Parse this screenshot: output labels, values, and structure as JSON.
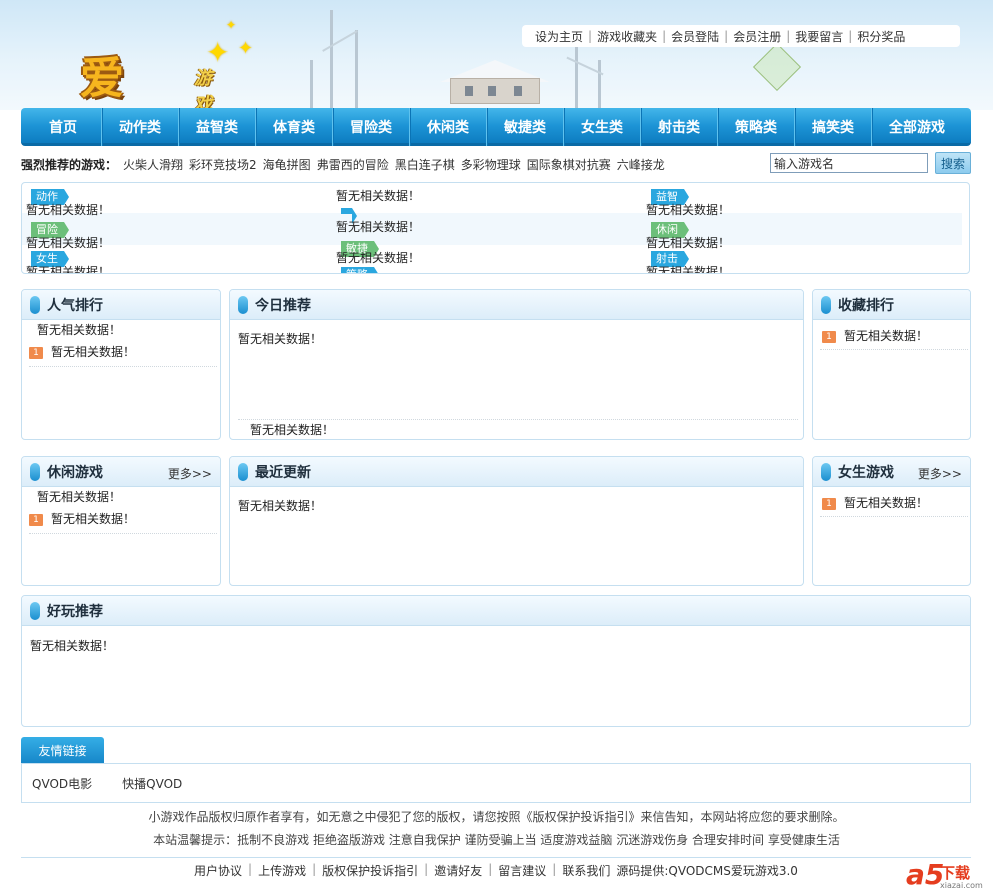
{
  "header": {
    "logo_main": "爱玩",
    "logo_sub": "游戏",
    "top_links": [
      "设为主页",
      "游戏收藏夹",
      "会员登陆",
      "会员注册",
      "我要留言",
      "积分奖品"
    ]
  },
  "nav": [
    "首页",
    "动作类",
    "益智类",
    "体育类",
    "冒险类",
    "休闲类",
    "敏捷类",
    "女生类",
    "射击类",
    "策略类",
    "搞笑类",
    "全部游戏"
  ],
  "recommend": {
    "label": "强烈推荐的游戏：",
    "games": [
      "火柴人滑翔",
      "彩环竞技场2",
      "海龟拼图",
      "弗雷西的冒险",
      "黑白连子棋",
      "多彩物理球",
      "国际象棋对抗赛",
      "六峰接龙"
    ]
  },
  "search": {
    "placeholder": "输入游戏名",
    "button": "搜索"
  },
  "empty_text": "暂无相关数据！",
  "categories": {
    "action": "动作",
    "puzzle": "益智",
    "sports": "体育",
    "adventure": "冒险",
    "casual": "休闲",
    "agile": "敏捷",
    "girls": "女生",
    "strategy": "策略",
    "shooting": "射击"
  },
  "panels": {
    "popular": "人气排行",
    "today": "今日推荐",
    "favorite": "收藏排行",
    "casual_games": "休闲游戏",
    "latest": "最近更新",
    "girls_games": "女生游戏",
    "fun": "好玩推荐",
    "more": "更多>>",
    "rank_number": "1"
  },
  "friends": {
    "tab": "友情链接",
    "links": [
      "QVOD电影",
      "快播QVOD"
    ]
  },
  "footer": {
    "copyright": "小游戏作品版权归原作者享有，如无意之中侵犯了您的版权，请您按照《版权保护投诉指引》来信告知，本网站将应您的要求删除。",
    "tips": "本站温馨提示：抵制不良游戏  拒绝盗版游戏  注意自我保护  谨防受骗上当  适度游戏益脑  沉迷游戏伤身  合理安排时间  享受健康生活",
    "links": [
      "用户协议",
      "上传游戏",
      "版权保护投诉指引",
      "邀请好友",
      "留言建议",
      "联系我们"
    ],
    "source": "源码提供:QVODCMS爱玩游戏3.0"
  },
  "watermark": {
    "mark": "a5",
    "name": "下载",
    "url": "xiazai.com"
  },
  "colors": {
    "nav": "#1d94d6",
    "accent": "#0d7cc0",
    "tag_blue": "#2aa7df",
    "tag_green": "#6cbf7a",
    "rank": "#f08a4b"
  }
}
